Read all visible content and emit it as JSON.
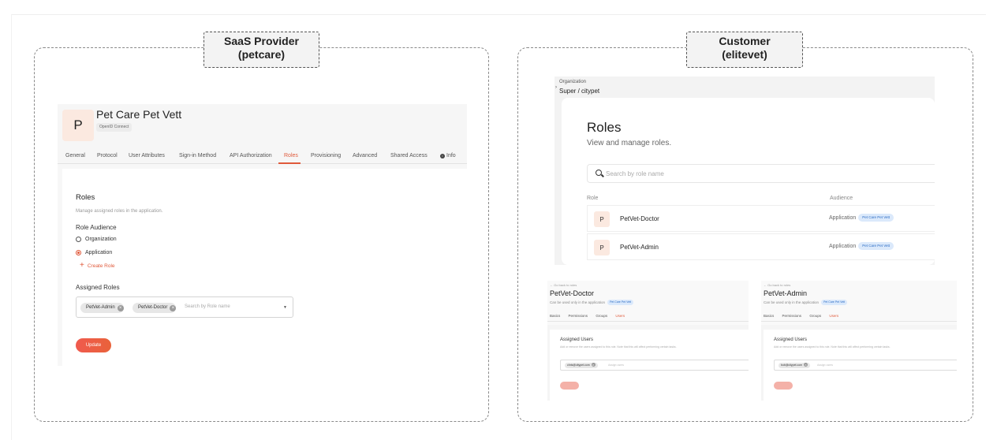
{
  "groups": {
    "provider": {
      "line1": "SaaS Provider",
      "line2": "(petcare)"
    },
    "customer": {
      "line1": "Customer",
      "line2": "(elitevet)"
    }
  },
  "provider_app": {
    "avatar_letter": "P",
    "title": "Pet Care Pet Vett",
    "protocol_chip": "OpenID Connect",
    "tabs": [
      "General",
      "Protocol",
      "User Attributes",
      "Sign-in Method",
      "API Authorization",
      "Roles",
      "Provisioning",
      "Advanced",
      "Shared Access",
      "Info"
    ],
    "active_tab": "Roles",
    "roles_section": {
      "title": "Roles",
      "subtitle": "Manage assigned roles in the application.",
      "audience_label": "Role Audience",
      "audience_options": [
        "Organization",
        "Application"
      ],
      "audience_selected": "Application",
      "create_role": "Create Role",
      "assigned_label": "Assigned Roles",
      "assigned_roles": [
        "PetVet-Admin",
        "PetVet-Doctor"
      ],
      "search_placeholder": "Search by Role name",
      "update_button": "Update"
    }
  },
  "customer_console": {
    "org_label": "Organization",
    "org_path": "Super / citypet",
    "title": "Roles",
    "subtitle": "View and manage roles.",
    "search_placeholder": "Search by role name",
    "columns": {
      "role": "Role",
      "audience": "Audience"
    },
    "rows": [
      {
        "avatar": "P",
        "name": "PetVet-Doctor",
        "audience": "Application",
        "app": "Pet Care Pet Vett"
      },
      {
        "avatar": "P",
        "name": "PetVet-Admin",
        "audience": "Application",
        "app": "Pet Care Pet Vett"
      }
    ]
  },
  "role_details": [
    {
      "back": "← Go back to roles",
      "title": "PetVet-Doctor",
      "subtitle": "Can be used only in the application",
      "app_chip": "Pet Care Pet Vett",
      "tabs": [
        "Basics",
        "Permissions",
        "Groups",
        "Users"
      ],
      "active_tab": "Users",
      "section_title": "Assigned Users",
      "section_desc": "Add or remove the users assigned to this role. Note that this will affect performing certain tasks.",
      "user_tag": "chris@citypet.com",
      "placeholder": "Assign users"
    },
    {
      "back": "← Go back to roles",
      "title": "PetVet-Admin",
      "subtitle": "Can be used only in the application",
      "app_chip": "Pet Care Pet Vett",
      "tabs": [
        "Basics",
        "Permissions",
        "Groups",
        "Users"
      ],
      "active_tab": "Users",
      "section_title": "Assigned Users",
      "section_desc": "Add or remove the users assigned to this role. Note that this will affect performing certain tasks.",
      "user_tag": "bob@citypet.com",
      "placeholder": "Assign users"
    }
  ],
  "colors": {
    "accent": "#e05a3b",
    "chip_blue_bg": "#dbe9fb",
    "chip_blue_text": "#2b6cc4",
    "avatar_bg": "#fbe9e0"
  }
}
